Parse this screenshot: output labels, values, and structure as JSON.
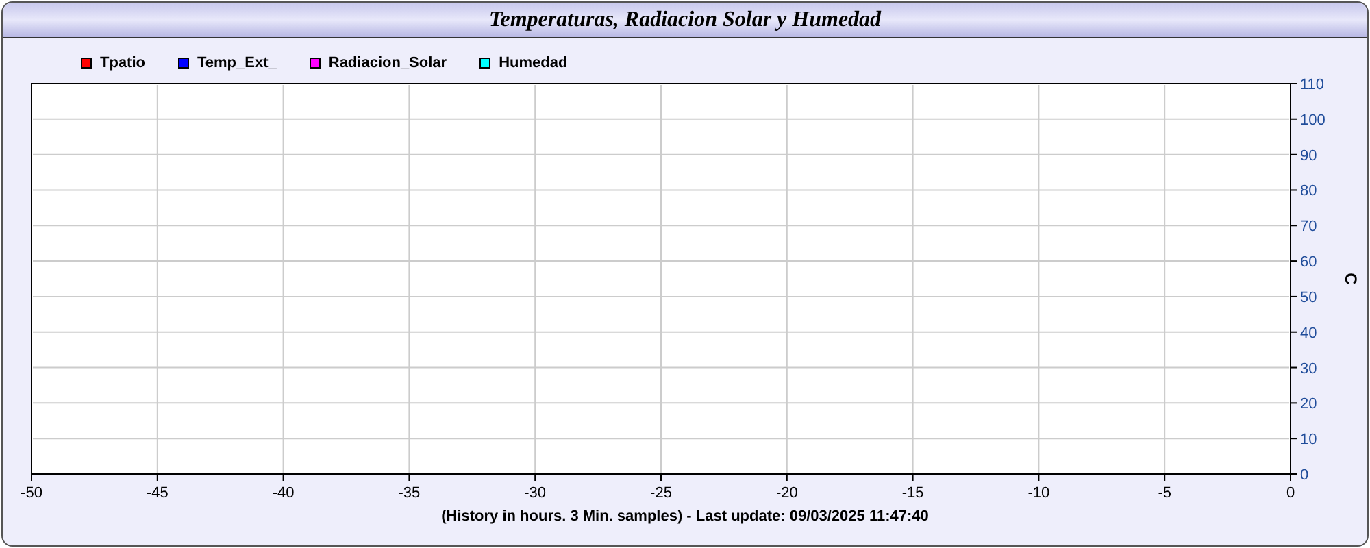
{
  "panel": {
    "title": "Temperaturas, Radiacion Solar y Humedad"
  },
  "chart_data": {
    "type": "line",
    "ylabel": "C",
    "ylim": [
      0,
      110
    ],
    "grid": true,
    "categories": [
      "-50",
      "-45",
      "-40",
      "-35",
      "-30",
      "-25",
      "-20",
      "-15",
      "-10",
      "-5",
      "0"
    ],
    "yticks": [
      0,
      10,
      20,
      30,
      40,
      50,
      60,
      70,
      80,
      90,
      100,
      110
    ],
    "series": [
      {
        "name": "Tpatio",
        "color": "#ff0000",
        "values": [
          null,
          null,
          null,
          null,
          null,
          null,
          null,
          null,
          null,
          null,
          null
        ]
      },
      {
        "name": "Temp_Ext_",
        "color": "#0000ff",
        "values": [
          null,
          null,
          null,
          null,
          null,
          null,
          null,
          null,
          null,
          null,
          null
        ]
      },
      {
        "name": "Radiacion_Solar",
        "color": "#ff00ff",
        "values": [
          null,
          null,
          null,
          null,
          null,
          null,
          null,
          null,
          null,
          null,
          null
        ]
      },
      {
        "name": "Humedad",
        "color": "#00ffff",
        "values": [
          null,
          null,
          null,
          null,
          null,
          null,
          null,
          null,
          null,
          null,
          null
        ]
      }
    ]
  },
  "footer": "(History in hours. 3 Min. samples) - Last update: 09/03/2025 11:47:40"
}
